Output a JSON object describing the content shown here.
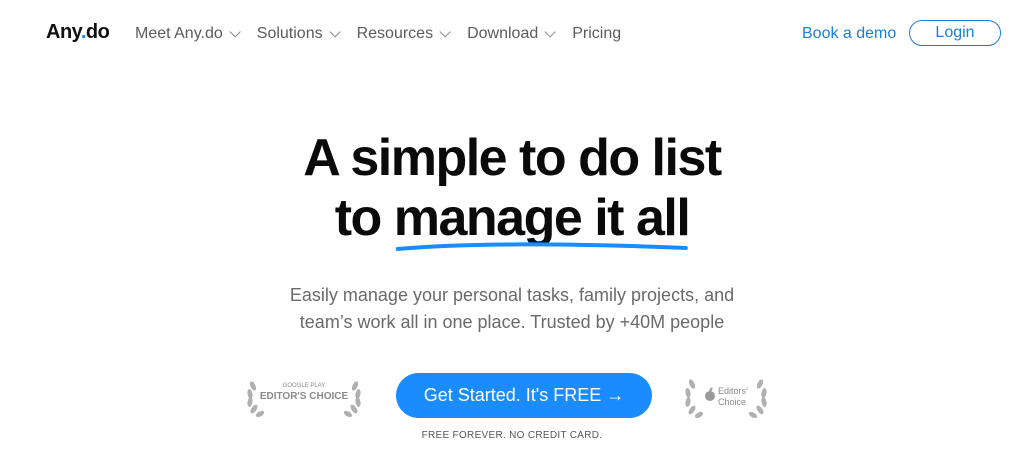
{
  "nav": {
    "logo": {
      "text": "Any",
      "dot": ".",
      "suffix": "do"
    },
    "items": [
      {
        "label": "Meet Any.do",
        "has_dropdown": true
      },
      {
        "label": "Solutions",
        "has_dropdown": true
      },
      {
        "label": "Resources",
        "has_dropdown": true
      },
      {
        "label": "Download",
        "has_dropdown": true
      },
      {
        "label": "Pricing",
        "has_dropdown": false
      }
    ],
    "book_demo": "Book a demo",
    "login": "Login"
  },
  "hero": {
    "line1": "A simple to do list",
    "line2_prefix": "to ",
    "line2_highlight": "manage it all",
    "subtitle_line1": "Easily manage your personal tasks, family projects, and",
    "subtitle_line2": "team’s work all in one place. Trusted by +40M people",
    "cta": "Get Started. It's FREE →",
    "note": "FREE FOREVER. NO CREDIT CARD."
  },
  "badges": {
    "google": {
      "top": "GOOGLE PLAY",
      "main": "EDITOR'S CHOICE"
    },
    "apple": {
      "line1": "Editors’",
      "line2": "Choice"
    }
  },
  "colors": {
    "accent": "#1a8cff",
    "link": "#1a7fd8",
    "text": "#0a0a0a",
    "muted": "#6a6a6a"
  }
}
